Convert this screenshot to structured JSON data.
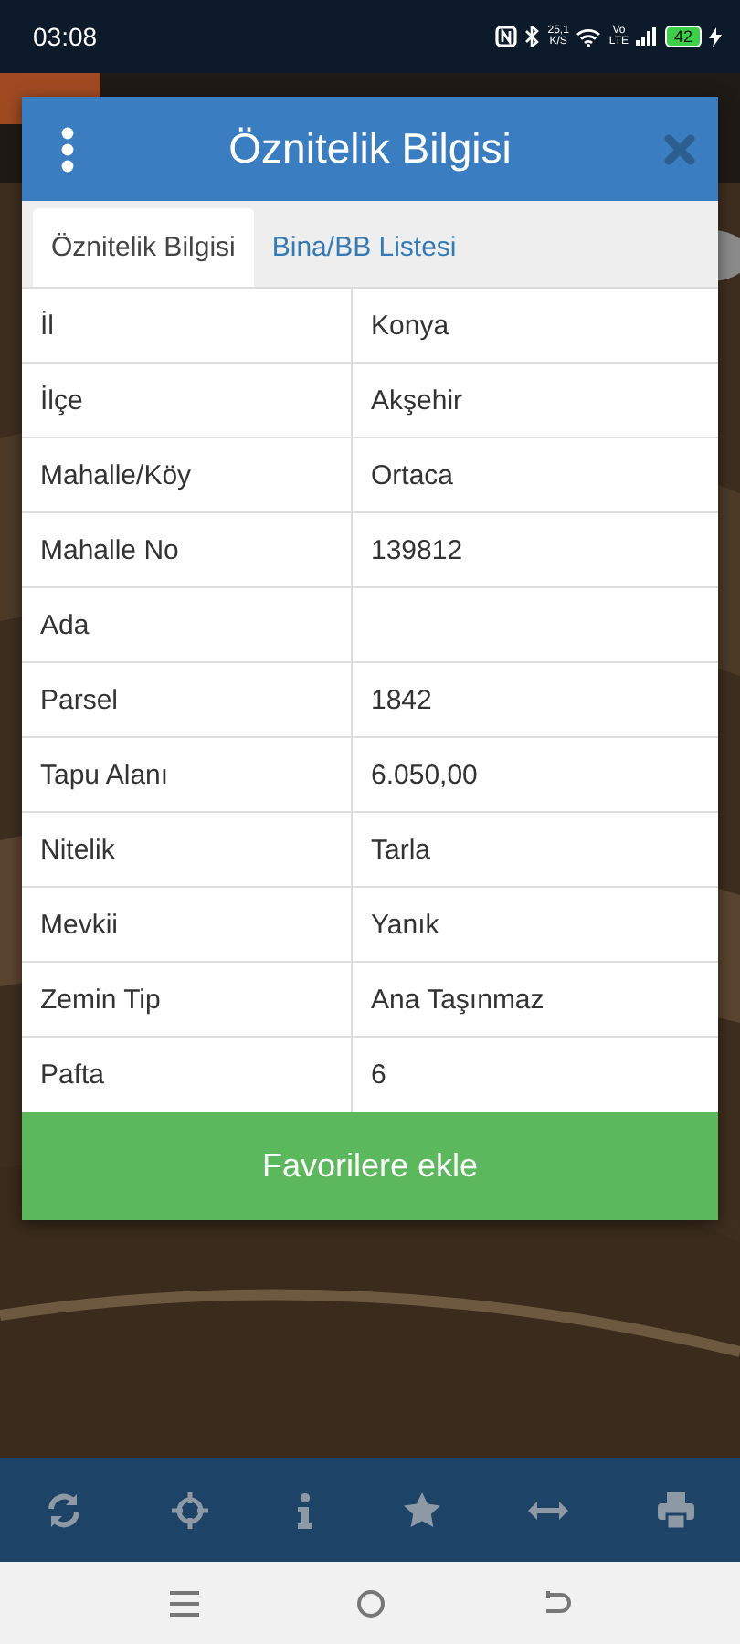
{
  "status_bar": {
    "time": "03:08",
    "net_speed": "25,1",
    "net_speed_unit": "K/S",
    "network_top": "Vo",
    "network_bottom": "LTE",
    "battery": "42"
  },
  "dialog": {
    "title": "Öznitelik Bilgisi",
    "tabs": [
      {
        "label": "Öznitelik Bilgisi",
        "selected": true
      },
      {
        "label": "Bina/BB Listesi",
        "selected": false
      }
    ],
    "rows": [
      {
        "label": "İl",
        "value": "Konya"
      },
      {
        "label": "İlçe",
        "value": "Akşehir"
      },
      {
        "label": "Mahalle/Köy",
        "value": "Ortaca"
      },
      {
        "label": "Mahalle No",
        "value": "139812"
      },
      {
        "label": "Ada"
      },
      {
        "label": "Parsel",
        "value": "1842"
      },
      {
        "label": "Tapu Alanı",
        "value": "6.050,00"
      },
      {
        "label": "Nitelik",
        "value": "Tarla"
      },
      {
        "label": "Mevkii",
        "value": "Yanık"
      },
      {
        "label": "Zemin Tip",
        "value": "Ana Taşınmaz"
      },
      {
        "label": "Pafta",
        "value": "6"
      }
    ],
    "button": "Favorilere ekle"
  },
  "toolbar": [
    {
      "kind": "refresh"
    },
    {
      "kind": "locate"
    },
    {
      "kind": "info"
    },
    {
      "kind": "star"
    },
    {
      "kind": "measure"
    },
    {
      "kind": "print"
    }
  ]
}
